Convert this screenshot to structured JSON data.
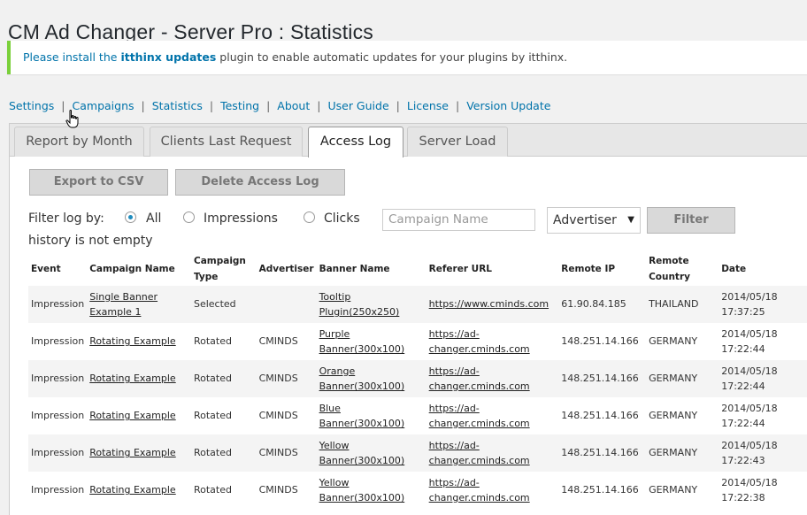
{
  "page": {
    "title": "CM Ad Changer - Server Pro : Statistics"
  },
  "notice": {
    "prefix": "Please install the",
    "plugin": "itthinx updates",
    "suffix": "plugin to enable automatic updates for your plugins by itthinx."
  },
  "nav": {
    "items": [
      "Settings",
      "Campaigns",
      "Statistics",
      "Testing",
      "About",
      "User Guide",
      "License",
      "Version Update"
    ],
    "separator": "|"
  },
  "tabs": {
    "items": [
      "Report by Month",
      "Clients Last Request",
      "Access Log",
      "Server Load"
    ],
    "active": "Access Log"
  },
  "actions": {
    "export": "Export to CSV",
    "delete": "Delete Access Log"
  },
  "filter": {
    "label": "Filter log by:",
    "options": [
      "All",
      "Impressions",
      "Clicks"
    ],
    "selected": "All",
    "campaign_placeholder": "Campaign Name",
    "advertiser_value": "Advertiser",
    "button": "Filter"
  },
  "history_note": "history is not empty",
  "table": {
    "headers": [
      "Event",
      "Campaign Name",
      "Campaign Type",
      "Advertiser",
      "Banner Name",
      "Referer URL",
      "Remote IP",
      "Remote Country",
      "Date"
    ],
    "rows": [
      {
        "event": "Impression",
        "campaign": "Single Banner Example 1",
        "type": "Selected",
        "advertiser": "",
        "banner": "Tooltip Plugin(250x250)",
        "referer": "https://www.cminds.com",
        "ip": "61.90.84.185",
        "country": "THAILAND",
        "date": "2014/05/18 17:37:25"
      },
      {
        "event": "Impression",
        "campaign": "Rotating Example",
        "type": "Rotated",
        "advertiser": "CMINDS",
        "banner": "Purple Banner(300x100)",
        "referer": "https://ad-changer.cminds.com",
        "ip": "148.251.14.166",
        "country": "GERMANY",
        "date": "2014/05/18 17:22:44"
      },
      {
        "event": "Impression",
        "campaign": "Rotating Example",
        "type": "Rotated",
        "advertiser": "CMINDS",
        "banner": "Orange Banner(300x100)",
        "referer": "https://ad-changer.cminds.com",
        "ip": "148.251.14.166",
        "country": "GERMANY",
        "date": "2014/05/18 17:22:44"
      },
      {
        "event": "Impression",
        "campaign": "Rotating Example",
        "type": "Rotated",
        "advertiser": "CMINDS",
        "banner": "Blue Banner(300x100)",
        "referer": "https://ad-changer.cminds.com",
        "ip": "148.251.14.166",
        "country": "GERMANY",
        "date": "2014/05/18 17:22:44"
      },
      {
        "event": "Impression",
        "campaign": "Rotating Example",
        "type": "Rotated",
        "advertiser": "CMINDS",
        "banner": "Yellow Banner(300x100)",
        "referer": "https://ad-changer.cminds.com",
        "ip": "148.251.14.166",
        "country": "GERMANY",
        "date": "2014/05/18 17:22:43"
      },
      {
        "event": "Impression",
        "campaign": "Rotating Example",
        "type": "Rotated",
        "advertiser": "CMINDS",
        "banner": "Yellow Banner(300x100)",
        "referer": "https://ad-changer.cminds.com",
        "ip": "148.251.14.166",
        "country": "GERMANY",
        "date": "2014/05/18 17:22:38"
      }
    ]
  },
  "icons": {
    "cursor": "hand-pointer-icon",
    "select_caret": "chevron-down-icon"
  },
  "colors": {
    "link": "#0073aa",
    "notice_border": "#7ad03a",
    "radio_checked": "#1e8cbe"
  }
}
